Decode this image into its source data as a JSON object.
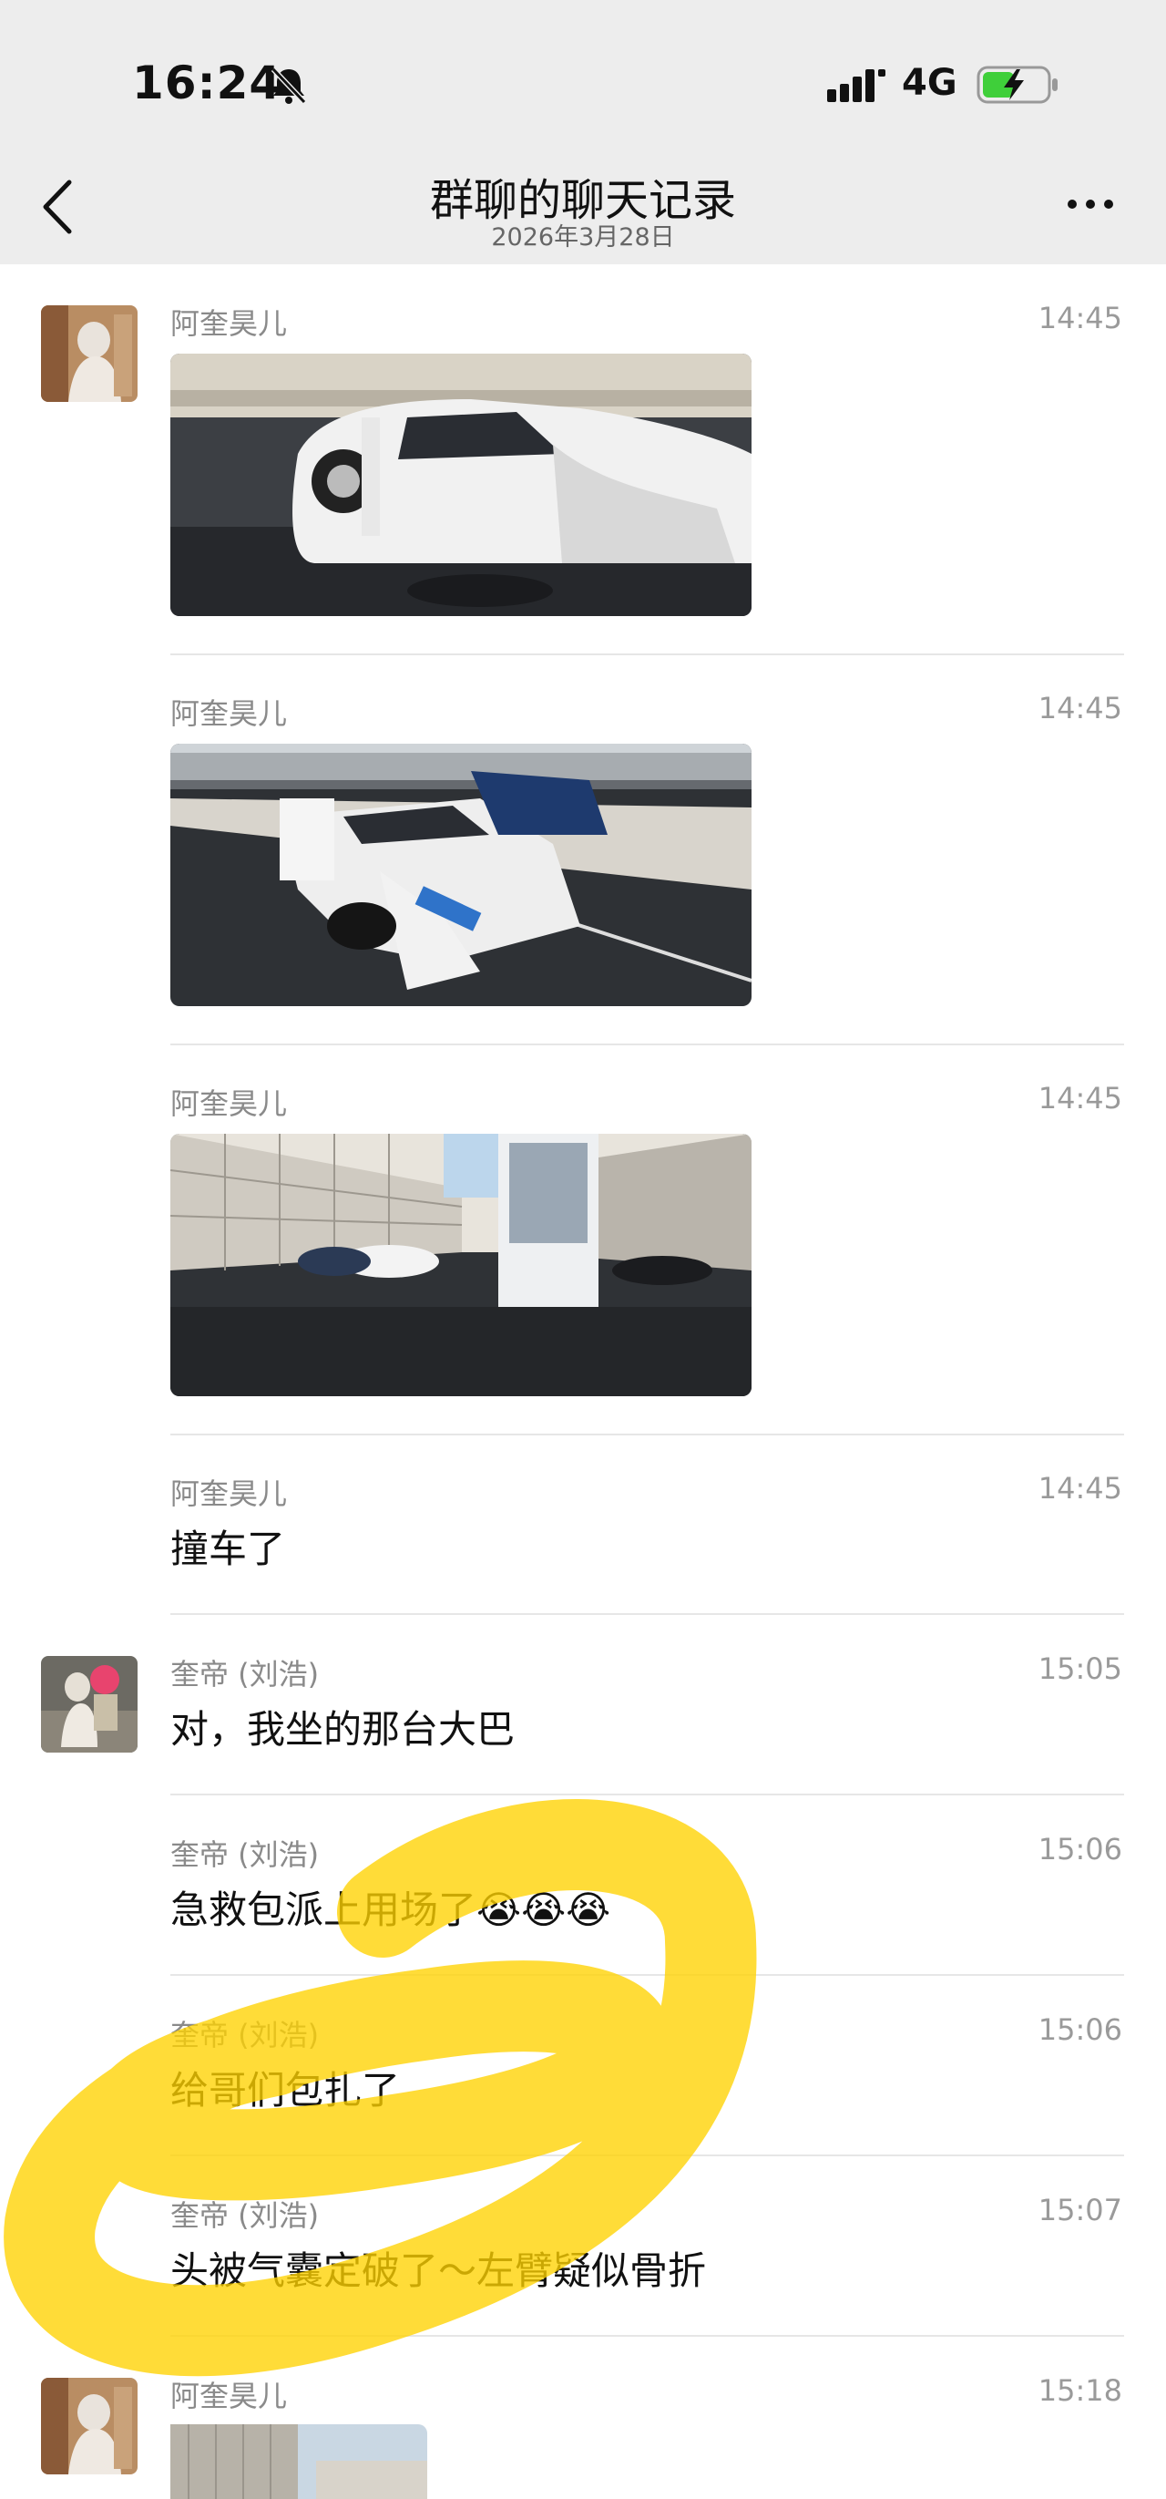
{
  "status_bar": {
    "time": "16:24",
    "network": "4G"
  },
  "header": {
    "title": "群聊的聊天记录",
    "date": "2026年3月28日"
  },
  "messages": [
    {
      "sender": "阿奎昊儿",
      "time": "14:45",
      "type": "image"
    },
    {
      "sender": "阿奎昊儿",
      "time": "14:45",
      "type": "image"
    },
    {
      "sender": "阿奎昊儿",
      "time": "14:45",
      "type": "image"
    },
    {
      "sender": "阿奎昊儿",
      "time": "14:45",
      "type": "text",
      "text": "撞车了"
    },
    {
      "sender": "奎帝 (刘浩)",
      "time": "15:05",
      "type": "text",
      "text": "对，我坐的那台大巴"
    },
    {
      "sender": "奎帝 (刘浩)",
      "time": "15:06",
      "type": "text",
      "text": "急救包派上用场了",
      "emoji": "😭😭😭"
    },
    {
      "sender": "奎帝 (刘浩)",
      "time": "15:06",
      "type": "text",
      "text": "给哥们包扎了"
    },
    {
      "sender": "奎帝 (刘浩)",
      "time": "15:07",
      "type": "text",
      "text": "头被气囊定破了～左臂疑似骨折"
    },
    {
      "sender": "阿奎昊儿",
      "time": "15:18",
      "type": "image"
    }
  ],
  "colors": {
    "header_bg": "#ededed",
    "highlight": "#ffd200",
    "battery": "#3fcf3a"
  }
}
